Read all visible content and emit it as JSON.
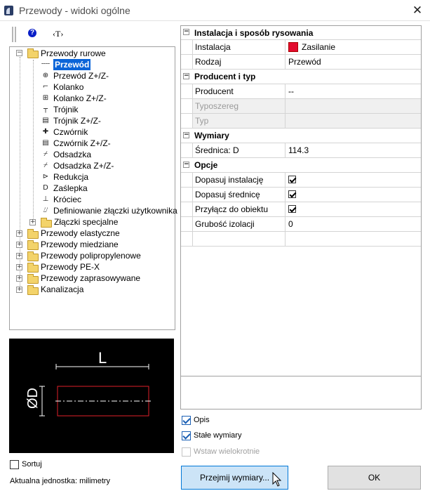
{
  "window": {
    "title": "Przewody - widoki ogólne",
    "close_glyph": "✕"
  },
  "toolbar": {
    "help_glyph": "?",
    "t_glyph": "‹T›"
  },
  "tree": {
    "root": "Przewody rurowe",
    "children": [
      {
        "label": "Przewód",
        "icon": "pipe-icon",
        "selected": true
      },
      {
        "label": "Przewód Z+/Z-",
        "icon": "pipe-z-icon"
      },
      {
        "label": "Kolanko",
        "icon": "elbow-icon"
      },
      {
        "label": "Kolanko Z+/Z-",
        "icon": "elbow-z-icon"
      },
      {
        "label": "Trójnik",
        "icon": "tee-icon"
      },
      {
        "label": "Trójnik Z+/Z-",
        "icon": "tee-z-icon"
      },
      {
        "label": "Czwórnik",
        "icon": "cross-icon"
      },
      {
        "label": "Czwórnik Z+/Z-",
        "icon": "cross-z-icon"
      },
      {
        "label": "Odsadzka",
        "icon": "offset-icon"
      },
      {
        "label": "Odsadzka Z+/Z-",
        "icon": "offset-z-icon"
      },
      {
        "label": "Redukcja",
        "icon": "reducer-icon"
      },
      {
        "label": "Zaślepka",
        "icon": "cap-icon"
      },
      {
        "label": "Króciec",
        "icon": "stub-icon"
      },
      {
        "label": "Definiowanie złączki użytkownika",
        "icon": "user-fitting-icon"
      }
    ],
    "special": "Złączki specjalne",
    "others": [
      "Przewody elastyczne",
      "Przewody miedziane",
      "Przewody polipropylenowe",
      "Przewody PE-X",
      "Przewody zaprasowywane",
      "Kanalizacja"
    ]
  },
  "preview": {
    "length_label": "L",
    "diameter_label": "ØD"
  },
  "properties": {
    "section1": {
      "title": "Instalacja i sposób rysowania",
      "rows": [
        {
          "label": "Instalacja",
          "value": "Zasilanie"
        },
        {
          "label": "Rodzaj",
          "value": "Przewód"
        }
      ]
    },
    "section2": {
      "title": "Producent i typ",
      "rows": [
        {
          "label": "Producent",
          "value": "--"
        },
        {
          "label": "Typoszereg",
          "value": ""
        },
        {
          "label": "Typ",
          "value": ""
        }
      ]
    },
    "section3": {
      "title": "Wymiary",
      "rows": [
        {
          "label": "Średnica: D",
          "value": "114.3"
        }
      ]
    },
    "section4": {
      "title": "Opcje",
      "rows": [
        {
          "label": "Dopasuj instalację",
          "checked": true
        },
        {
          "label": "Dopasuj średnicę",
          "checked": true
        },
        {
          "label": "Przyłącz do obiektu",
          "checked": true
        },
        {
          "label": "Grubość izolacji",
          "value": "0"
        }
      ]
    },
    "swatch_color": "#e30b2d"
  },
  "options": {
    "opis": "Opis",
    "stale_wymiary": "Stałe wymiary",
    "wstaw_wielokrotnie": "Wstaw wielokrotnie",
    "sortuj": "Sortuj"
  },
  "unit_label": "Aktualna jednostka: milimetry",
  "buttons": {
    "accept": "Przejmij wymiary...",
    "ok": "OK"
  }
}
